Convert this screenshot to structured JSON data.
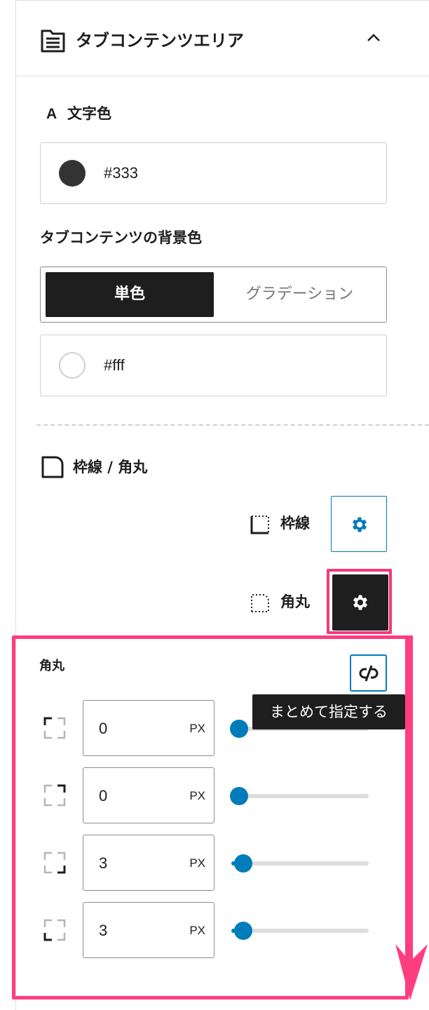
{
  "section": {
    "title": "タブコンテンツエリア"
  },
  "text_color": {
    "letter": "A",
    "label": "文字色",
    "value": "#333",
    "swatch": "#333333"
  },
  "bg": {
    "label": "タブコンテンツの背景色",
    "segments": [
      {
        "label": "単色",
        "active": true
      },
      {
        "label": "グラデーション",
        "active": false
      }
    ],
    "value": "#fff",
    "swatch": "#ffffff"
  },
  "border_radius": {
    "title": "枠線 / 角丸",
    "border_label": "枠線",
    "radius_label": "角丸",
    "panel_label": "角丸",
    "tooltip": "まとめて指定する",
    "unit": "PX",
    "slider_max": 100,
    "corners": [
      {
        "value": "0"
      },
      {
        "value": "0"
      },
      {
        "value": "3"
      },
      {
        "value": "3"
      }
    ]
  },
  "colors": {
    "accent": "#007cba",
    "highlight": "#ff3d7f",
    "dark": "#1e1e1e"
  },
  "icons": [
    "document-icon",
    "chevron-up-icon",
    "gear-icon",
    "unlink-icon",
    "border-icon",
    "radius-icon",
    "corner-icon"
  ]
}
